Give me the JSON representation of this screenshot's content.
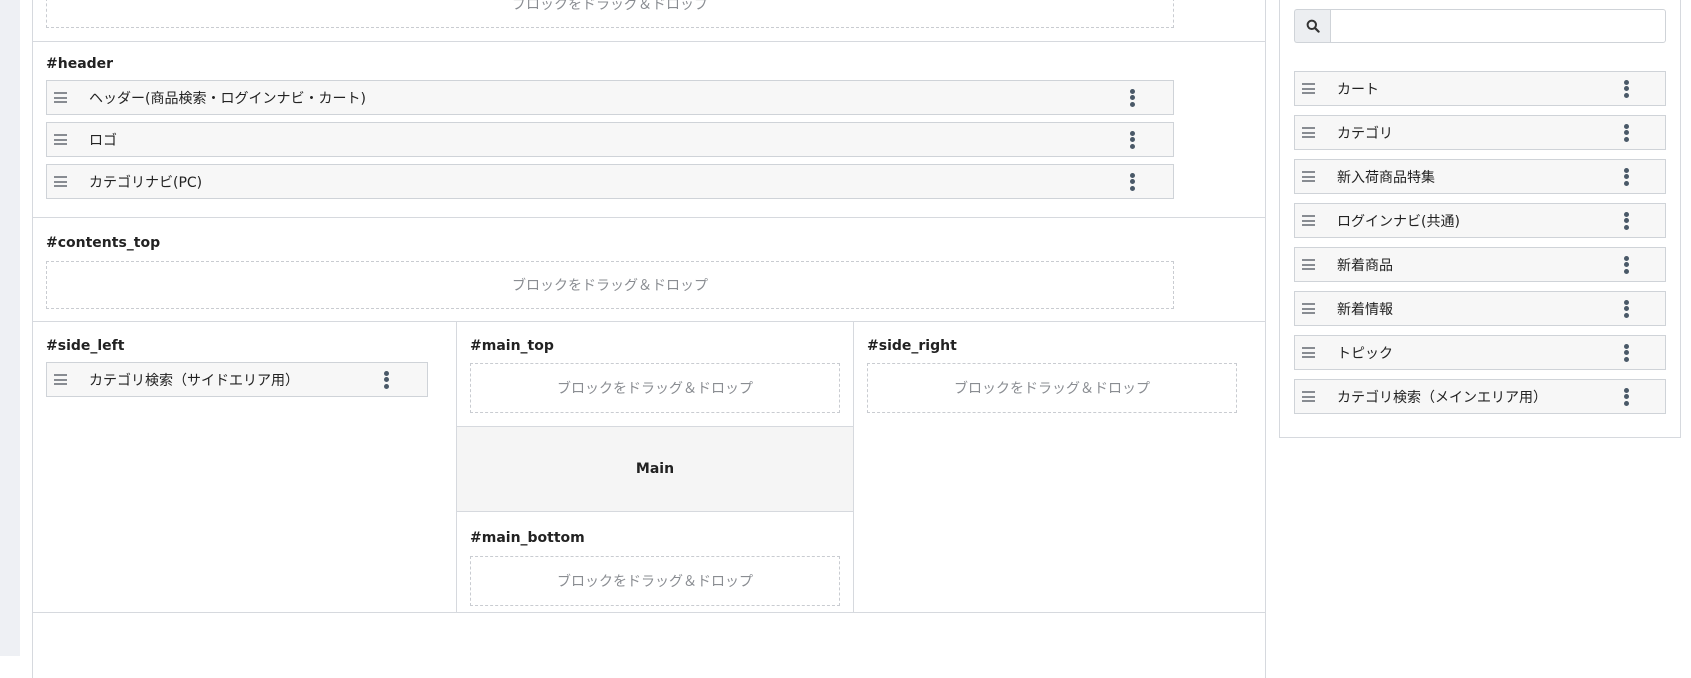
{
  "dropzone_text": "ブロックをドラッグ＆ドロップ",
  "sections": {
    "header": {
      "label": "#header",
      "blocks": [
        {
          "label": "ヘッダー(商品検索・ログインナビ・カート)"
        },
        {
          "label": "ロゴ"
        },
        {
          "label": "カテゴリナビ(PC)"
        }
      ]
    },
    "contents_top": {
      "label": "#contents_top"
    },
    "side_left": {
      "label": "#side_left",
      "blocks": [
        {
          "label": "カテゴリ検索（サイドエリア用）"
        }
      ]
    },
    "main_top": {
      "label": "#main_top"
    },
    "main": {
      "label": "Main"
    },
    "main_bottom": {
      "label": "#main_bottom"
    },
    "side_right": {
      "label": "#side_right"
    }
  },
  "block_library": {
    "search": {
      "value": "",
      "placeholder": ""
    },
    "icon": "search-icon",
    "items": [
      {
        "label": "カート"
      },
      {
        "label": "カテゴリ"
      },
      {
        "label": "新入荷商品特集"
      },
      {
        "label": "ログインナビ(共通)"
      },
      {
        "label": "新着商品"
      },
      {
        "label": "新着情報"
      },
      {
        "label": "トピック"
      },
      {
        "label": "カテゴリ検索（メインエリア用）"
      }
    ]
  },
  "colors": {
    "border": "#d6d9de",
    "block_bg": "#f7f7f7",
    "kebab": "#4a5968",
    "dropzone_text": "#8a8d92"
  }
}
